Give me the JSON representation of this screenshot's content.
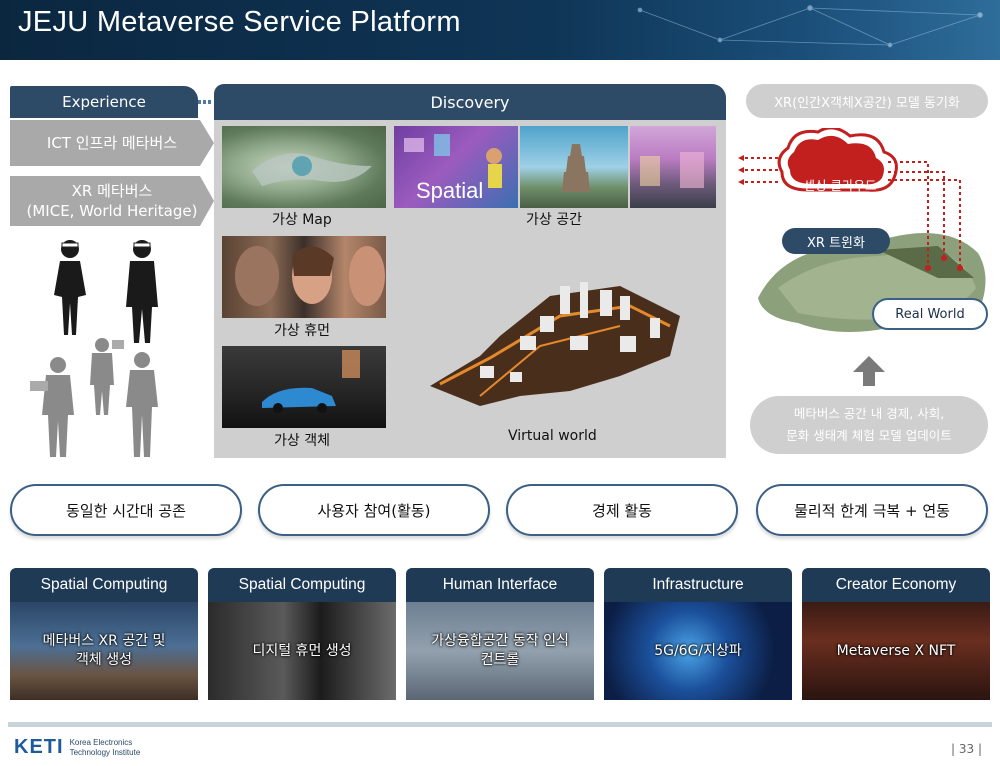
{
  "header": {
    "title": "JEJU Metaverse Service Platform"
  },
  "experience": {
    "tab": "Experience",
    "items": [
      "ICT 인프라 메타버스",
      "XR 메타버스",
      "(MICE, World Heritage)"
    ]
  },
  "discovery": {
    "tab": "Discovery",
    "captions": {
      "map": "가상 Map",
      "space": "가상 공간",
      "human": "가상 휴먼",
      "object": "가상 객체",
      "world": "Virtual world"
    },
    "spatial_overlay": "Spatial"
  },
  "right": {
    "top_pill": "XR(인간X객체X공간) 모델 동기화",
    "cloud": "센싱 클라우드",
    "xr_twin": "XR 트윈화",
    "real_world": "Real World",
    "bottom_lines": [
      "메타버스 공간 내 경제, 사회,",
      "문화 생태계 체험 모델 업데이트"
    ]
  },
  "pills": [
    "동일한 시간대 공존",
    "사용자 참여(활동)",
    "경제 활동",
    "물리적 한계 극복 + 연동"
  ],
  "cards": [
    {
      "title": "Spatial Computing",
      "line1": "메타버스 XR 공간 및",
      "line2": "객체 생성"
    },
    {
      "title": "Spatial Computing",
      "line1": "디지털 휴먼 생성",
      "line2": ""
    },
    {
      "title": "Human Interface",
      "line1": "가상융합공간 동작 인식",
      "line2": "컨트롤"
    },
    {
      "title": "Infrastructure",
      "line1": "5G/6G/지상파",
      "line2": ""
    },
    {
      "title": "Creator Economy",
      "line1": "Metaverse X NFT",
      "line2": ""
    }
  ],
  "footer": {
    "logo": "KETI",
    "logo_sub1": "Korea Electronics",
    "logo_sub2": "Technology Institute",
    "page": "| 33 |"
  },
  "colors": {
    "navy": "#2d4a67",
    "gray": "#a9a9a9",
    "cloud_red": "#c21f1f"
  }
}
